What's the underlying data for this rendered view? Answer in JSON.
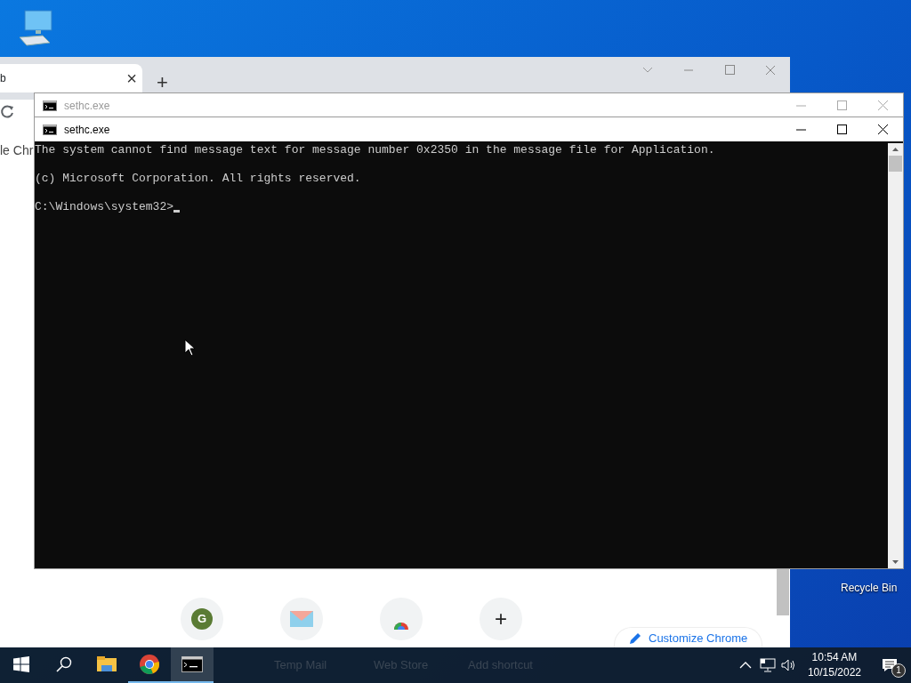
{
  "desktop_icons": [
    {
      "kind": "computer"
    },
    {
      "kind": "recycle",
      "label": "Recycle Bin"
    }
  ],
  "browser": {
    "tab_title": "b",
    "tab_close": "×",
    "new_tab": "+",
    "page_text": "le Chr",
    "shortcuts": [
      {
        "kind": "letter",
        "letter": "G"
      },
      {
        "kind": "mail",
        "label": "Temp Mail"
      },
      {
        "kind": "store",
        "label": "Web Store"
      },
      {
        "kind": "add",
        "symbol": "+",
        "label": "Add shortcut"
      }
    ],
    "customize_button": "Customize Chrome"
  },
  "console_windows": [
    {
      "title": "sethc.exe",
      "active": false
    },
    {
      "title": "sethc.exe",
      "active": true,
      "lines": [
        "The system cannot find message text for message number 0x2350 in the message file for Application.",
        "(c) Microsoft Corporation. All rights reserved.",
        "C:\\Windows\\system32>"
      ]
    }
  ],
  "taskbar": {
    "apps": [
      {
        "kind": "explorer",
        "running": false,
        "selected": false
      },
      {
        "kind": "chrome",
        "running": true,
        "selected": false
      },
      {
        "kind": "console",
        "running": true,
        "selected": true
      }
    ],
    "time": "10:54 AM",
    "date": "10/15/2022",
    "notification_count": "1"
  }
}
